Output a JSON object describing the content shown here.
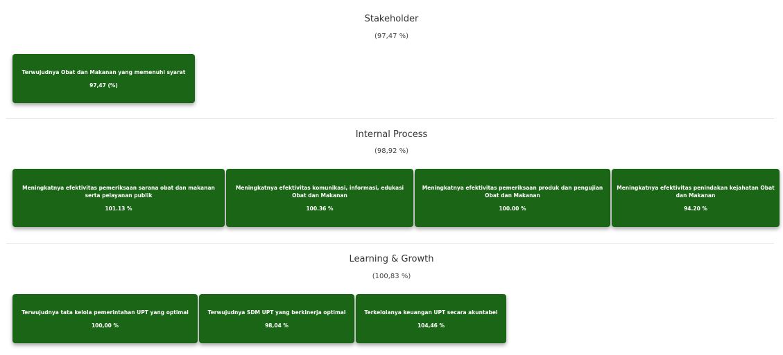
{
  "colors": {
    "card_bg": "#1b6616",
    "card_text": "#ffffff",
    "divider": "#e7e7e7"
  },
  "sections": [
    {
      "title": "Stakeholder",
      "score": "(97,47 %)",
      "cards": [
        {
          "label": "Terwujudnya Obat dan Makanan yang memenuhi syarat",
          "value": "97,47 (%)"
        }
      ]
    },
    {
      "title": "Internal Process",
      "score": "(98,92 %)",
      "cards": [
        {
          "label": "Meningkatnya efektivitas pemeriksaan sarana obat dan makanan serta pelayanan publik",
          "value": "101.13 %"
        },
        {
          "label": "Meningkatnya efektivitas komunikasi, informasi, edukasi Obat dan Makanan",
          "value": "100.36 %"
        },
        {
          "label": "Meningkatnya efektivitas pemeriksaan produk dan pengujian Obat dan Makanan",
          "value": "100.00 %"
        },
        {
          "label": "Meningkatnya efektivitas penindakan kejahatan Obat dan Makanan",
          "value": "94.20 %"
        }
      ]
    },
    {
      "title": "Learning & Growth",
      "score": "(100,83 %)",
      "cards": [
        {
          "label": "Terwujudnya tata kelola pemerintahan UPT yang optimal",
          "value": "100,00 %"
        },
        {
          "label": "Terwujudnya SDM UPT yang berkinerja optimal",
          "value": "98,04 %"
        },
        {
          "label": "Terkelolanya keuangan UPT secara akuntabel",
          "value": "104,46 %"
        }
      ]
    }
  ]
}
